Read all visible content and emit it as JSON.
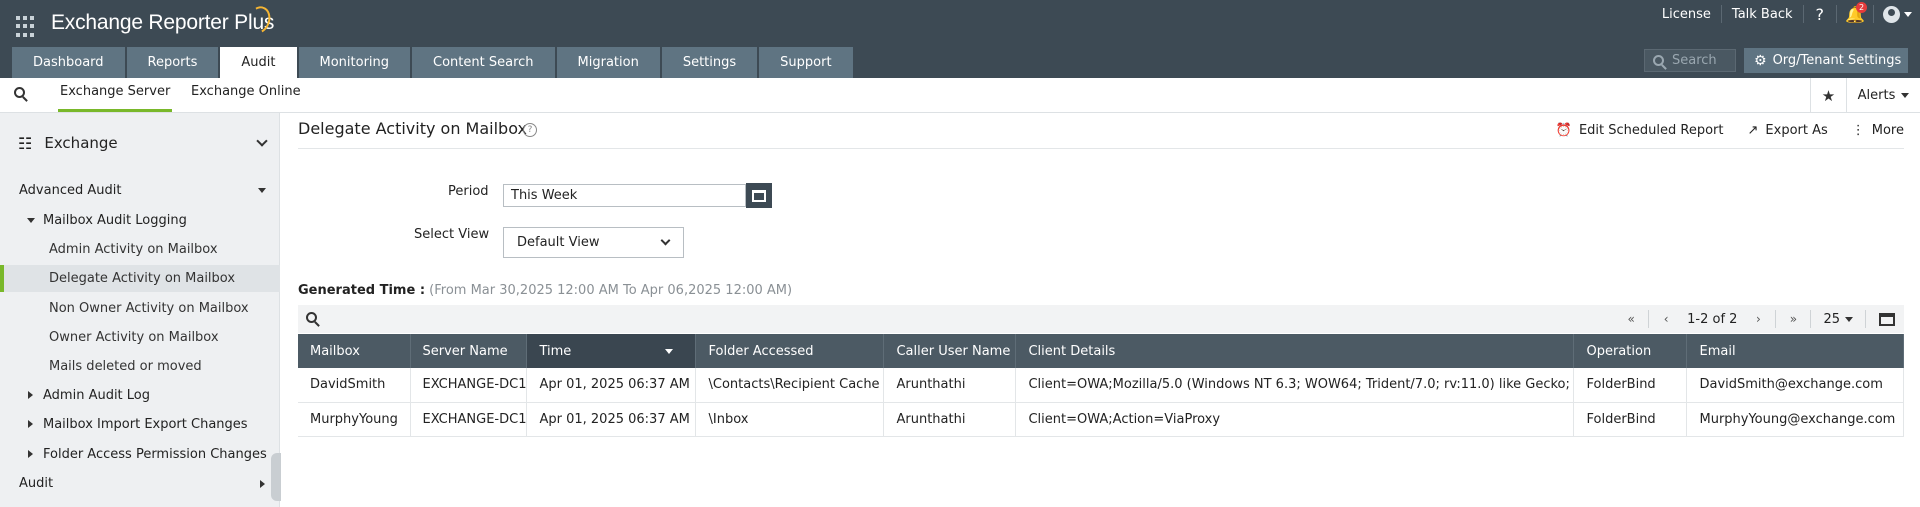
{
  "app": {
    "title": "Exchange Reporter Plus"
  },
  "top_links": {
    "license": "License",
    "talk_back": "Talk Back",
    "help": "?",
    "notification_count": "2"
  },
  "tabs": [
    {
      "label": "Dashboard"
    },
    {
      "label": "Reports"
    },
    {
      "label": "Audit"
    },
    {
      "label": "Monitoring"
    },
    {
      "label": "Content Search"
    },
    {
      "label": "Migration"
    },
    {
      "label": "Settings"
    },
    {
      "label": "Support"
    }
  ],
  "search": {
    "placeholder": "Search"
  },
  "org_settings": {
    "label": "Org/Tenant Settings"
  },
  "subnav": {
    "tabs": [
      {
        "label": "Exchange Server"
      },
      {
        "label": "Exchange Online"
      }
    ],
    "alerts": "Alerts"
  },
  "sidebar": {
    "header": "Exchange",
    "items": [
      {
        "label": "Advanced Audit"
      },
      {
        "label": "Mailbox Audit Logging"
      },
      {
        "label": "Admin Activity on Mailbox"
      },
      {
        "label": "Delegate Activity on Mailbox"
      },
      {
        "label": "Non Owner Activity on Mailbox"
      },
      {
        "label": "Owner Activity on Mailbox"
      },
      {
        "label": "Mails deleted or moved"
      },
      {
        "label": "Admin Audit Log"
      },
      {
        "label": "Mailbox Import Export Changes"
      },
      {
        "label": "Folder Access Permission Changes"
      },
      {
        "label": "Audit"
      }
    ]
  },
  "page": {
    "title": "Delegate Activity on Mailbox",
    "help": "?",
    "actions": {
      "schedule": "Edit Scheduled Report",
      "export": "Export As",
      "more": "More"
    },
    "period_label": "Period",
    "period_value": "This Week",
    "view_label": "Select View",
    "view_value": "Default View",
    "generated_label": "Generated Time :",
    "generated_range": "(From Mar 30,2025 12:00 AM To Apr 06,2025 12:00 AM)"
  },
  "pager": {
    "info": "1-2 of 2",
    "page_size": "25"
  },
  "table": {
    "columns": [
      "Mailbox",
      "Server Name",
      "Time",
      "Folder Accessed",
      "Caller User Name",
      "Client Details",
      "Operation",
      "Email"
    ],
    "rows": [
      [
        "DavidSmith",
        "EXCHANGE-DC1",
        "Apr 01, 2025 06:37 AM",
        "\\Contacts\\Recipient Cache",
        "Arunthathi",
        "Client=OWA;Mozilla/5.0 (Windows NT 6.3; WOW64; Trident/7.0; rv:11.0) like Gecko;",
        "FolderBind",
        "DavidSmith@exchange.com"
      ],
      [
        "MurphyYoung",
        "EXCHANGE-DC1",
        "Apr 01, 2025 06:37 AM",
        "\\Inbox",
        "Arunthathi",
        "Client=OWA;Action=ViaProxy",
        "FolderBind",
        "MurphyYoung@exchange.com"
      ]
    ]
  },
  "colors": {
    "header_bg": "#3d4a54",
    "tab_bg": "#5f7482",
    "accent_green": "#79b82a",
    "table_header": "#4c5a64"
  }
}
